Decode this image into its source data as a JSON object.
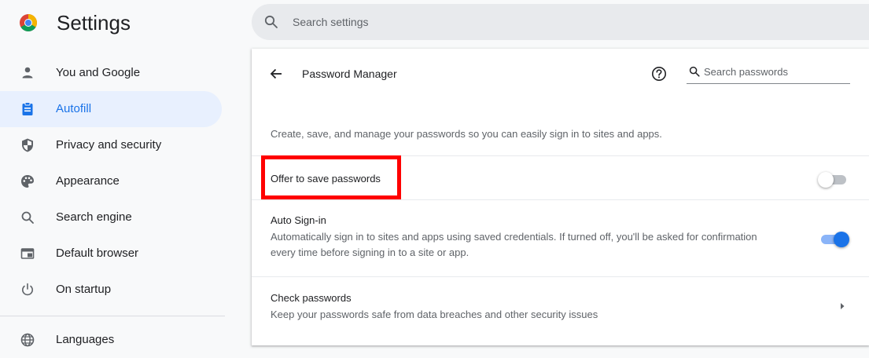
{
  "header": {
    "app_title": "Settings",
    "search_placeholder": "Search settings",
    "logo_icon": "chrome-logo"
  },
  "sidebar": {
    "items": [
      {
        "label": "You and Google",
        "icon": "person-icon",
        "active": false
      },
      {
        "label": "Autofill",
        "icon": "clipboard-icon",
        "active": true
      },
      {
        "label": "Privacy and security",
        "icon": "shield-icon",
        "active": false
      },
      {
        "label": "Appearance",
        "icon": "palette-icon",
        "active": false
      },
      {
        "label": "Search engine",
        "icon": "search-icon",
        "active": false
      },
      {
        "label": "Default browser",
        "icon": "browser-window-icon",
        "active": false
      },
      {
        "label": "On startup",
        "icon": "power-icon",
        "active": false
      },
      {
        "label": "Languages",
        "icon": "globe-icon",
        "active": false
      }
    ]
  },
  "main": {
    "title": "Password Manager",
    "search_passwords_placeholder": "Search passwords",
    "intro": "Create, save, and manage your passwords so you can easily sign in to sites and apps.",
    "offer_to_save": {
      "label": "Offer to save passwords",
      "enabled": false
    },
    "auto_signin": {
      "label": "Auto Sign-in",
      "description": "Automatically sign in to sites and apps using saved credentials. If turned off, you'll be asked for confirmation every time before signing in to a site or app.",
      "enabled": true
    },
    "check_passwords": {
      "label": "Check passwords",
      "description": "Keep your passwords safe from data breaches and other security issues"
    }
  },
  "colors": {
    "accent": "#1a73e8",
    "highlight": "#ff0000",
    "active_bg": "#e8f0fe"
  }
}
